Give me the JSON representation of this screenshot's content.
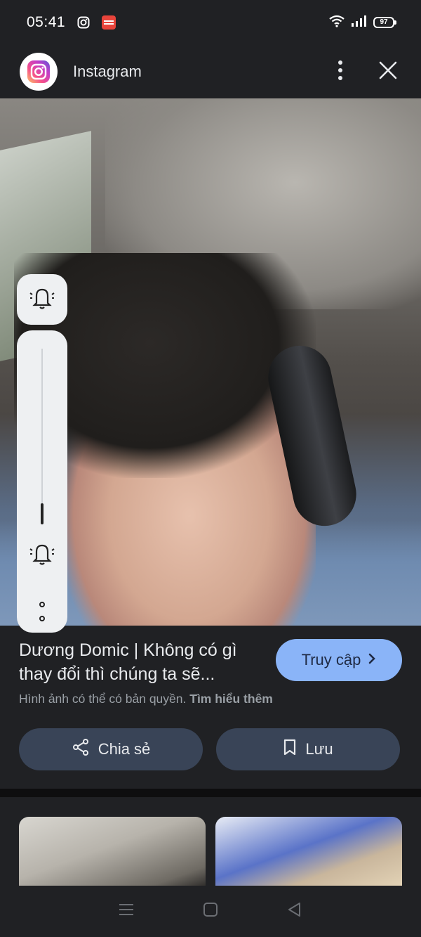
{
  "status_bar": {
    "time": "05:41",
    "battery": "97",
    "icons": [
      "instagram-icon",
      "manga-toon-icon",
      "wifi-icon",
      "signal-icon",
      "battery-icon"
    ]
  },
  "header": {
    "app_name": "Instagram",
    "icons": [
      "instagram-logo-icon",
      "more-vertical-icon",
      "close-icon"
    ]
  },
  "result": {
    "title": "Dương Domic | Không có gì thay đổi thì chúng ta sẽ...",
    "visit_label": "Truy cập",
    "copyright_text": "Hình ảnh có thể có bản quyền.",
    "learn_more": "Tìm hiểu thêm",
    "share_label": "Chia sẻ",
    "save_label": "Lưu"
  },
  "volume_panel": {
    "level_fraction": 0.05,
    "icons": [
      "bell-icon",
      "bell-icon",
      "more-icon"
    ]
  },
  "colors": {
    "background": "#202124",
    "accent_button": "#8ab4f8",
    "secondary_button": "#394457"
  }
}
